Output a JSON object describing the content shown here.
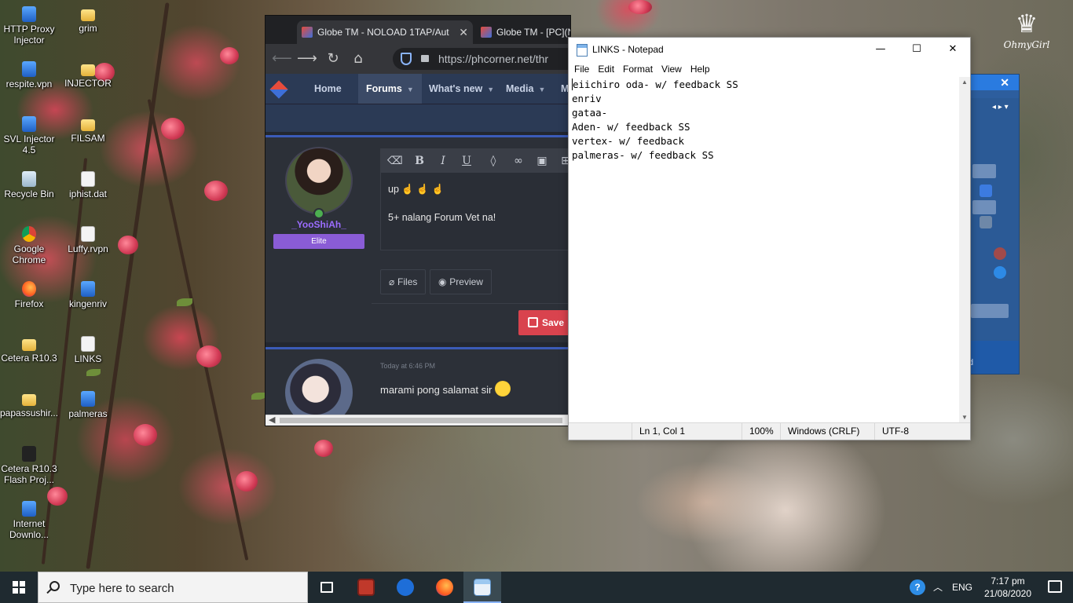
{
  "watermark": {
    "text": "OhmyGirl"
  },
  "desktop_icons": [
    {
      "label": "HTTP Proxy Injector",
      "icon": "blue"
    },
    {
      "label": "grim",
      "icon": "folder"
    },
    {
      "label": "respite.vpn",
      "icon": "blue"
    },
    {
      "label": "INJECTOR",
      "icon": "folder"
    },
    {
      "label": "SVL Injector 4.5",
      "icon": "blue"
    },
    {
      "label": "FILSAM",
      "icon": "folder"
    },
    {
      "label": "Recycle Bin",
      "icon": "recycle"
    },
    {
      "label": "iphist.dat",
      "icon": "doc"
    },
    {
      "label": "Google Chrome",
      "icon": "chrome"
    },
    {
      "label": "Luffy.rvpn",
      "icon": "doc"
    },
    {
      "label": "Firefox",
      "icon": "firefox"
    },
    {
      "label": "kingenriv",
      "icon": "blue"
    },
    {
      "label": "Cetera R10.3",
      "icon": "folder"
    },
    {
      "label": "LINKS",
      "icon": "doc"
    },
    {
      "label": "papassushir...",
      "icon": "folder"
    },
    {
      "label": "palmeras",
      "icon": "blue"
    },
    {
      "label": "Cetera R10.3 Flash Proj...",
      "icon": "flash"
    },
    {
      "label": "Internet Downlo...",
      "icon": "blue"
    }
  ],
  "browser": {
    "tabs": [
      {
        "title": "Globe TM - NOLOAD 1TAP/Aut",
        "close": "✕"
      },
      {
        "title": "Globe TM - [PC](NoLoad)Sino",
        "close": "✕"
      }
    ],
    "new_tab": "+",
    "url": "https://phcorner.net/thr",
    "nav": [
      {
        "label": "Home",
        "caret": ""
      },
      {
        "label": "Forums",
        "caret": "▼"
      },
      {
        "label": "What's new",
        "caret": "▼"
      },
      {
        "label": "Media",
        "caret": "▼"
      },
      {
        "label": "M",
        "caret": ""
      }
    ],
    "post1": {
      "username": "_YooShiAh_",
      "rank": "Elite",
      "editor_line1": "up ☝ ☝ ☝",
      "editor_line2": "5+ nalang Forum Vet na!",
      "files_label": "Files",
      "preview_label": "Preview",
      "save_label": "Save"
    },
    "post2": {
      "time": "Today at 6:46 PM",
      "message": "marami pong salamat sir"
    }
  },
  "notepad": {
    "title": "LINKS - Notepad",
    "menu": [
      "File",
      "Edit",
      "Format",
      "View",
      "Help"
    ],
    "lines": [
      "eiichiro oda- w/ feedback SS",
      "enriv",
      "gataa-",
      "Aden- w/ feedback SS",
      "vertex- w/ feedback",
      "palmeras- w/ feedback SS"
    ],
    "status": {
      "position": "Ln 1, Col 1",
      "zoom": "100%",
      "line_ending": "Windows (CRLF)",
      "encoding": "UTF-8"
    }
  },
  "side_window": {
    "footer_text": "d"
  },
  "taskbar": {
    "search_placeholder": "Type here to search",
    "language": "ENG",
    "time": "7:17 pm",
    "date": "21/08/2020"
  }
}
